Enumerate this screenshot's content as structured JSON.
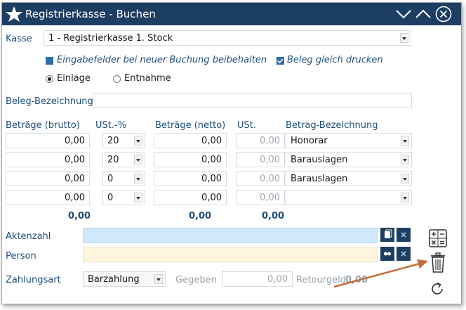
{
  "window": {
    "title": "Registrierkasse - Buchen"
  },
  "kasse": {
    "label": "Kasse",
    "value": "1 - Registrierkasse 1. Stock"
  },
  "options": {
    "keep_fields_label": "Eingabefelder bei neuer Buchung beibehalten",
    "keep_fields_checked": true,
    "print_receipt_label": "Beleg gleich drucken",
    "print_receipt_checked": true
  },
  "booking_type": {
    "einlage": "Einlage",
    "entnahme": "Entnahme",
    "selected": "Einlage"
  },
  "beleg": {
    "label": "Beleg-Bezeichnung",
    "value": ""
  },
  "table": {
    "headers": {
      "brutto": "Beträge (brutto)",
      "ust_pct": "USt.-%",
      "netto": "Beträge (netto)",
      "ust": "USt.",
      "bezeichnung": "Betrag-Bezeichnung"
    },
    "rows": [
      {
        "brutto": "0,00",
        "ust_pct": "20",
        "netto": "0,00",
        "ust": "0,00",
        "bezeichnung": "Honorar"
      },
      {
        "brutto": "0,00",
        "ust_pct": "20",
        "netto": "0,00",
        "ust": "0,00",
        "bezeichnung": "Barauslagen"
      },
      {
        "brutto": "0,00",
        "ust_pct": "0",
        "netto": "0,00",
        "ust": "0,00",
        "bezeichnung": "Barauslagen"
      },
      {
        "brutto": "0,00",
        "ust_pct": "0",
        "netto": "0,00",
        "ust": "0,00",
        "bezeichnung": ""
      }
    ],
    "totals": {
      "brutto": "0,00",
      "netto": "0,00",
      "ust": "0,00"
    }
  },
  "akten": {
    "label": "Aktenzahl",
    "value": "",
    "color": "#cfe8fb"
  },
  "person": {
    "label": "Person",
    "value": "",
    "color": "#fdf6dc"
  },
  "payment": {
    "label": "Zahlungsart",
    "value": "Barzahlung",
    "given_label": "Gegeben",
    "given_value": "0,00",
    "change_label": "Retourgeld",
    "change_value": "0,00"
  },
  "icons": {
    "title": "star-icon",
    "collapse": "chevron-down-icon",
    "expand": "chevron-up-icon",
    "close": "close-icon",
    "calculator": "calculator-icon",
    "delete": "trash-icon",
    "refresh": "refresh-icon"
  },
  "colors": {
    "titlebar": "#1d3e63",
    "label": "#1f4e79",
    "annotation_arrow": "#c0703a"
  }
}
